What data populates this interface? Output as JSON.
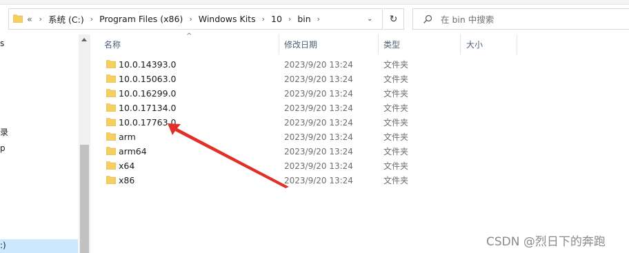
{
  "address_bar": {
    "overflow_label": "«",
    "crumbs": [
      "系统 (C:)",
      "Program Files (x86)",
      "Windows Kits",
      "10",
      "bin"
    ],
    "separator": "›",
    "dropdown_glyph": "⌄"
  },
  "refresh_glyph": "↻",
  "search": {
    "placeholder": "在 bin 中搜索"
  },
  "nav_pane": {
    "fragments": [
      "s",
      "录",
      "p",
      ":)"
    ]
  },
  "columns": {
    "name": "名称",
    "date": "修改日期",
    "type": "类型",
    "size": "大小",
    "sort_glyph": "^"
  },
  "files": [
    {
      "name": "10.0.14393.0",
      "date": "2023/9/20 13:24",
      "type": "文件夹"
    },
    {
      "name": "10.0.15063.0",
      "date": "2023/9/20 13:24",
      "type": "文件夹"
    },
    {
      "name": "10.0.16299.0",
      "date": "2023/9/20 13:24",
      "type": "文件夹"
    },
    {
      "name": "10.0.17134.0",
      "date": "2023/9/20 13:24",
      "type": "文件夹"
    },
    {
      "name": "10.0.17763.0",
      "date": "2023/9/20 13:24",
      "type": "文件夹"
    },
    {
      "name": "arm",
      "date": "2023/9/20 13:24",
      "type": "文件夹"
    },
    {
      "name": "arm64",
      "date": "2023/9/20 13:24",
      "type": "文件夹"
    },
    {
      "name": "x64",
      "date": "2023/9/20 13:24",
      "type": "文件夹"
    },
    {
      "name": "x86",
      "date": "2023/9/20 13:24",
      "type": "文件夹"
    }
  ],
  "watermark": "CSDN @烈日下的奔跑",
  "colors": {
    "folder": "#f4cf62",
    "folder_dark": "#e8b43a",
    "arrow": "#e03028",
    "selection": "#cce8ff"
  },
  "icons": {
    "folder": "folder-icon",
    "search": "search-icon",
    "refresh": "refresh-icon",
    "annotation": "red-arrow-annotation"
  }
}
